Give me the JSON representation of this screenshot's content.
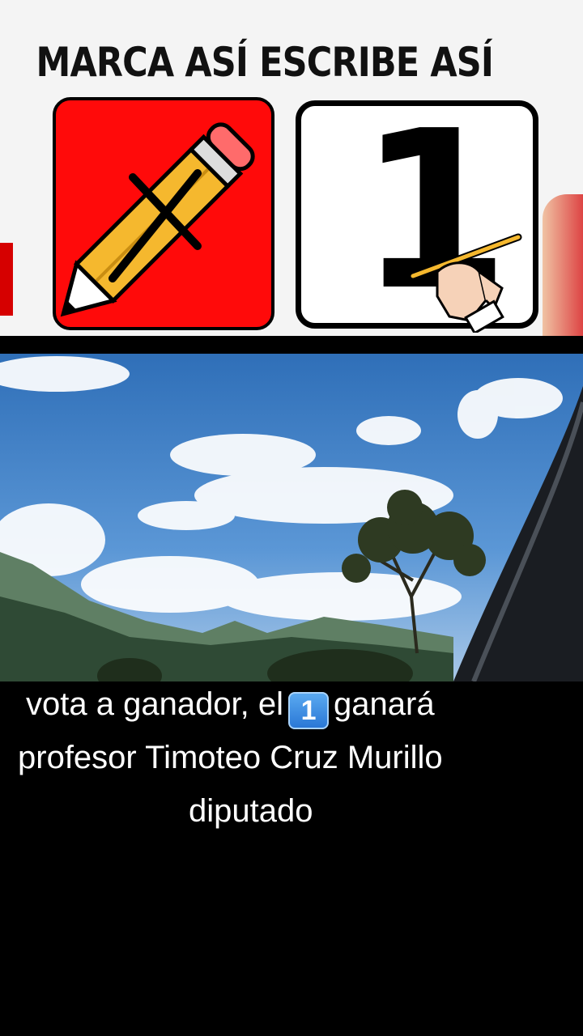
{
  "banner": {
    "title": "MARCA ASÍ ESCRIBE ASÍ",
    "mark_symbol": "pencil-with-x",
    "write_digit": "1"
  },
  "caption": {
    "line1_before": "vota a ganador, el",
    "keycap": "1",
    "line1_after": "ganará",
    "line2": "profesor Timoteo Cruz Murillo",
    "line3": "diputado"
  },
  "colors": {
    "mark_box": "#ff0a0a",
    "pencil_body": "#f5b82e",
    "sky": "#3f7fc6",
    "keycap": "#3b8fe4"
  }
}
